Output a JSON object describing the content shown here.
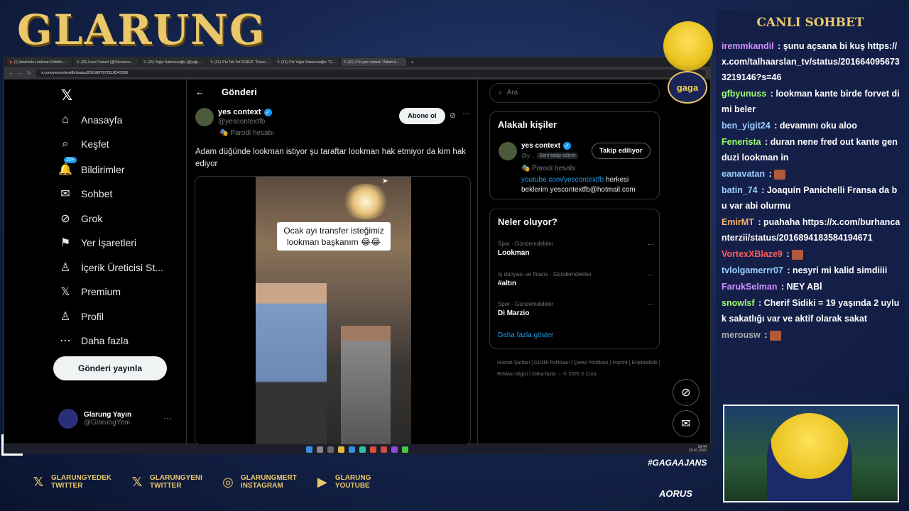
{
  "overlay": {
    "brand_title": "GLARUNG",
    "chat_title": "CANLI SOHBET",
    "gaga_badge": "gaga",
    "hashtag": "#GAGAAJANS",
    "sponsor": "AORUS",
    "socials": [
      {
        "icon": "x-icon",
        "glyph": "𝕏",
        "line1": "GLARUNGYEDEK",
        "line2": "TWITTER"
      },
      {
        "icon": "x-icon",
        "glyph": "𝕏",
        "line1": "GLARUNGYENI",
        "line2": "TWITTER"
      },
      {
        "icon": "instagram-icon",
        "glyph": "◎",
        "line1": "GLARUNGMERT",
        "line2": "INSTAGRAM"
      },
      {
        "icon": "youtube-icon",
        "glyph": "▶",
        "line1": "GLARUNG",
        "line2": "YOUTUBE"
      }
    ]
  },
  "browser": {
    "tabs": [
      "(1) Adeimola Lookman Dribblin...",
      "(20) Enes Comert (@10enesco...",
      "(21) Yağız Sabuncuoğlu (@yağı...",
      "(21) X'te Tek Yol FENER: \"Fener...",
      "(21) X'te Yağız Sabuncuoğlu: \"G...",
      "(21) X'te yes context: \"Adam d..."
    ],
    "url": "x.com/yescontextfb/status/2016897972110243166"
  },
  "nav": {
    "items": [
      {
        "label": "Anasayfa",
        "icon": "home-icon",
        "glyph": "⌂"
      },
      {
        "label": "Keşfet",
        "icon": "search-icon",
        "glyph": "⌕"
      },
      {
        "label": "Bildirimler",
        "icon": "bell-icon",
        "glyph": "🔔"
      },
      {
        "label": "Sohbet",
        "icon": "mail-icon",
        "glyph": "✉"
      },
      {
        "label": "Grok",
        "icon": "grok-icon",
        "glyph": "⊘"
      },
      {
        "label": "Yer İşaretleri",
        "icon": "bookmark-icon",
        "glyph": "⚑"
      },
      {
        "label": "İçerik Üreticisi St...",
        "icon": "creator-icon",
        "glyph": "♙"
      },
      {
        "label": "Premium",
        "icon": "x-icon",
        "glyph": "𝕏"
      },
      {
        "label": "Profil",
        "icon": "profile-icon",
        "glyph": "♙"
      },
      {
        "label": "Daha fazla",
        "icon": "more-icon",
        "glyph": "⋯"
      }
    ],
    "notif_badge": "20+",
    "post_button": "Gönderi yayınla",
    "account": {
      "name": "Glarung Yayın",
      "handle": "@GlarungYeni"
    }
  },
  "post": {
    "header": "Gönderi",
    "author": "yes context",
    "handle": "@yescontextfb",
    "parody": "Parodi hesabı",
    "follow_label": "Abone ol",
    "text": "Adam düğünde lookman istiyor şu taraftar lookman hak etmiyor da kim hak ediyor",
    "video_caption": "Ocak ayı transfer isteğimiz lookman başkanım 😂😂"
  },
  "sidebar": {
    "search_placeholder": "Ara",
    "related_title": "Alakalı kişiler",
    "related": {
      "name": "yes context",
      "handle": "@y...",
      "follows_you": "Seni takip ediyor",
      "button": "Takip ediliyor",
      "parody": "Parodi hesabı",
      "bio_link": "youtube.com/yescontextfb",
      "bio_rest": " herkesi beklerim yescontextfb@hotmail.com"
    },
    "trends_title": "Neler oluyor?",
    "trends": [
      {
        "category": "Spor · Gündemdekiler",
        "topic": "Lookman"
      },
      {
        "category": "İş dünyası ve finans · Gündemdekiler",
        "topic": "#altın"
      },
      {
        "category": "Spor · Gündemdekiler",
        "topic": "Di Marzio"
      }
    ],
    "show_more": "Daha fazla göster",
    "footer": "Hizmet Şartları  |  Gizlilik Politikası  |  Çerez Politikası  |  İmprint  |  Erişilebilirlik  |  Reklam bilgisi  |  Daha fazla ···  © 2026 X Corp."
  },
  "taskbar": {
    "time": "18:44",
    "date": "29.01.2026"
  },
  "chat": [
    {
      "user": "iremmkandil",
      "color": "#d08cff",
      "text": "şunu açsana bi kuş https://x.com/talhaarslan_tv/status/2016640956733219146?s=46"
    },
    {
      "user": "gfbyunuss",
      "color": "#9aff6a",
      "text": "lookman kante birde forvet dimi beler"
    },
    {
      "user": "ben_yigit24",
      "color": "#9ad0ff",
      "text": "devamını oku aloo"
    },
    {
      "user": "Fenerista",
      "color": "#9aff6a",
      "text": "duran nene fred out kante genduzi lookman in"
    },
    {
      "user": "eanavatan",
      "color": "#9ad0ff",
      "text": "",
      "emote": true
    },
    {
      "user": "batin_74",
      "color": "#9ad0ff",
      "text": "Joaquín Panichelli Fransa da bu var abi olurmu"
    },
    {
      "user": "EmirMT",
      "color": "#ffb36a",
      "text": "puahaha https://x.com/burhancanterzii/status/2016894183584194671"
    },
    {
      "user": "VortexXBlaze9",
      "color": "#ff5a5a",
      "text": "",
      "emote": true
    },
    {
      "user": "tvlolgamerrr07",
      "color": "#9ad0ff",
      "text": "nesyri mi kalid simdiiii"
    },
    {
      "user": "FarukSelman",
      "color": "#d08cff",
      "text": "NEY ABİ"
    },
    {
      "user": "snowlsf",
      "color": "#9aff6a",
      "text": "Cherif Sidiki = 19 yaşında 2 uyluk sakatlığı var ve aktif olarak sakat"
    },
    {
      "user": "merousw",
      "color": "#aaaaaa",
      "text": "",
      "emote": true
    }
  ]
}
